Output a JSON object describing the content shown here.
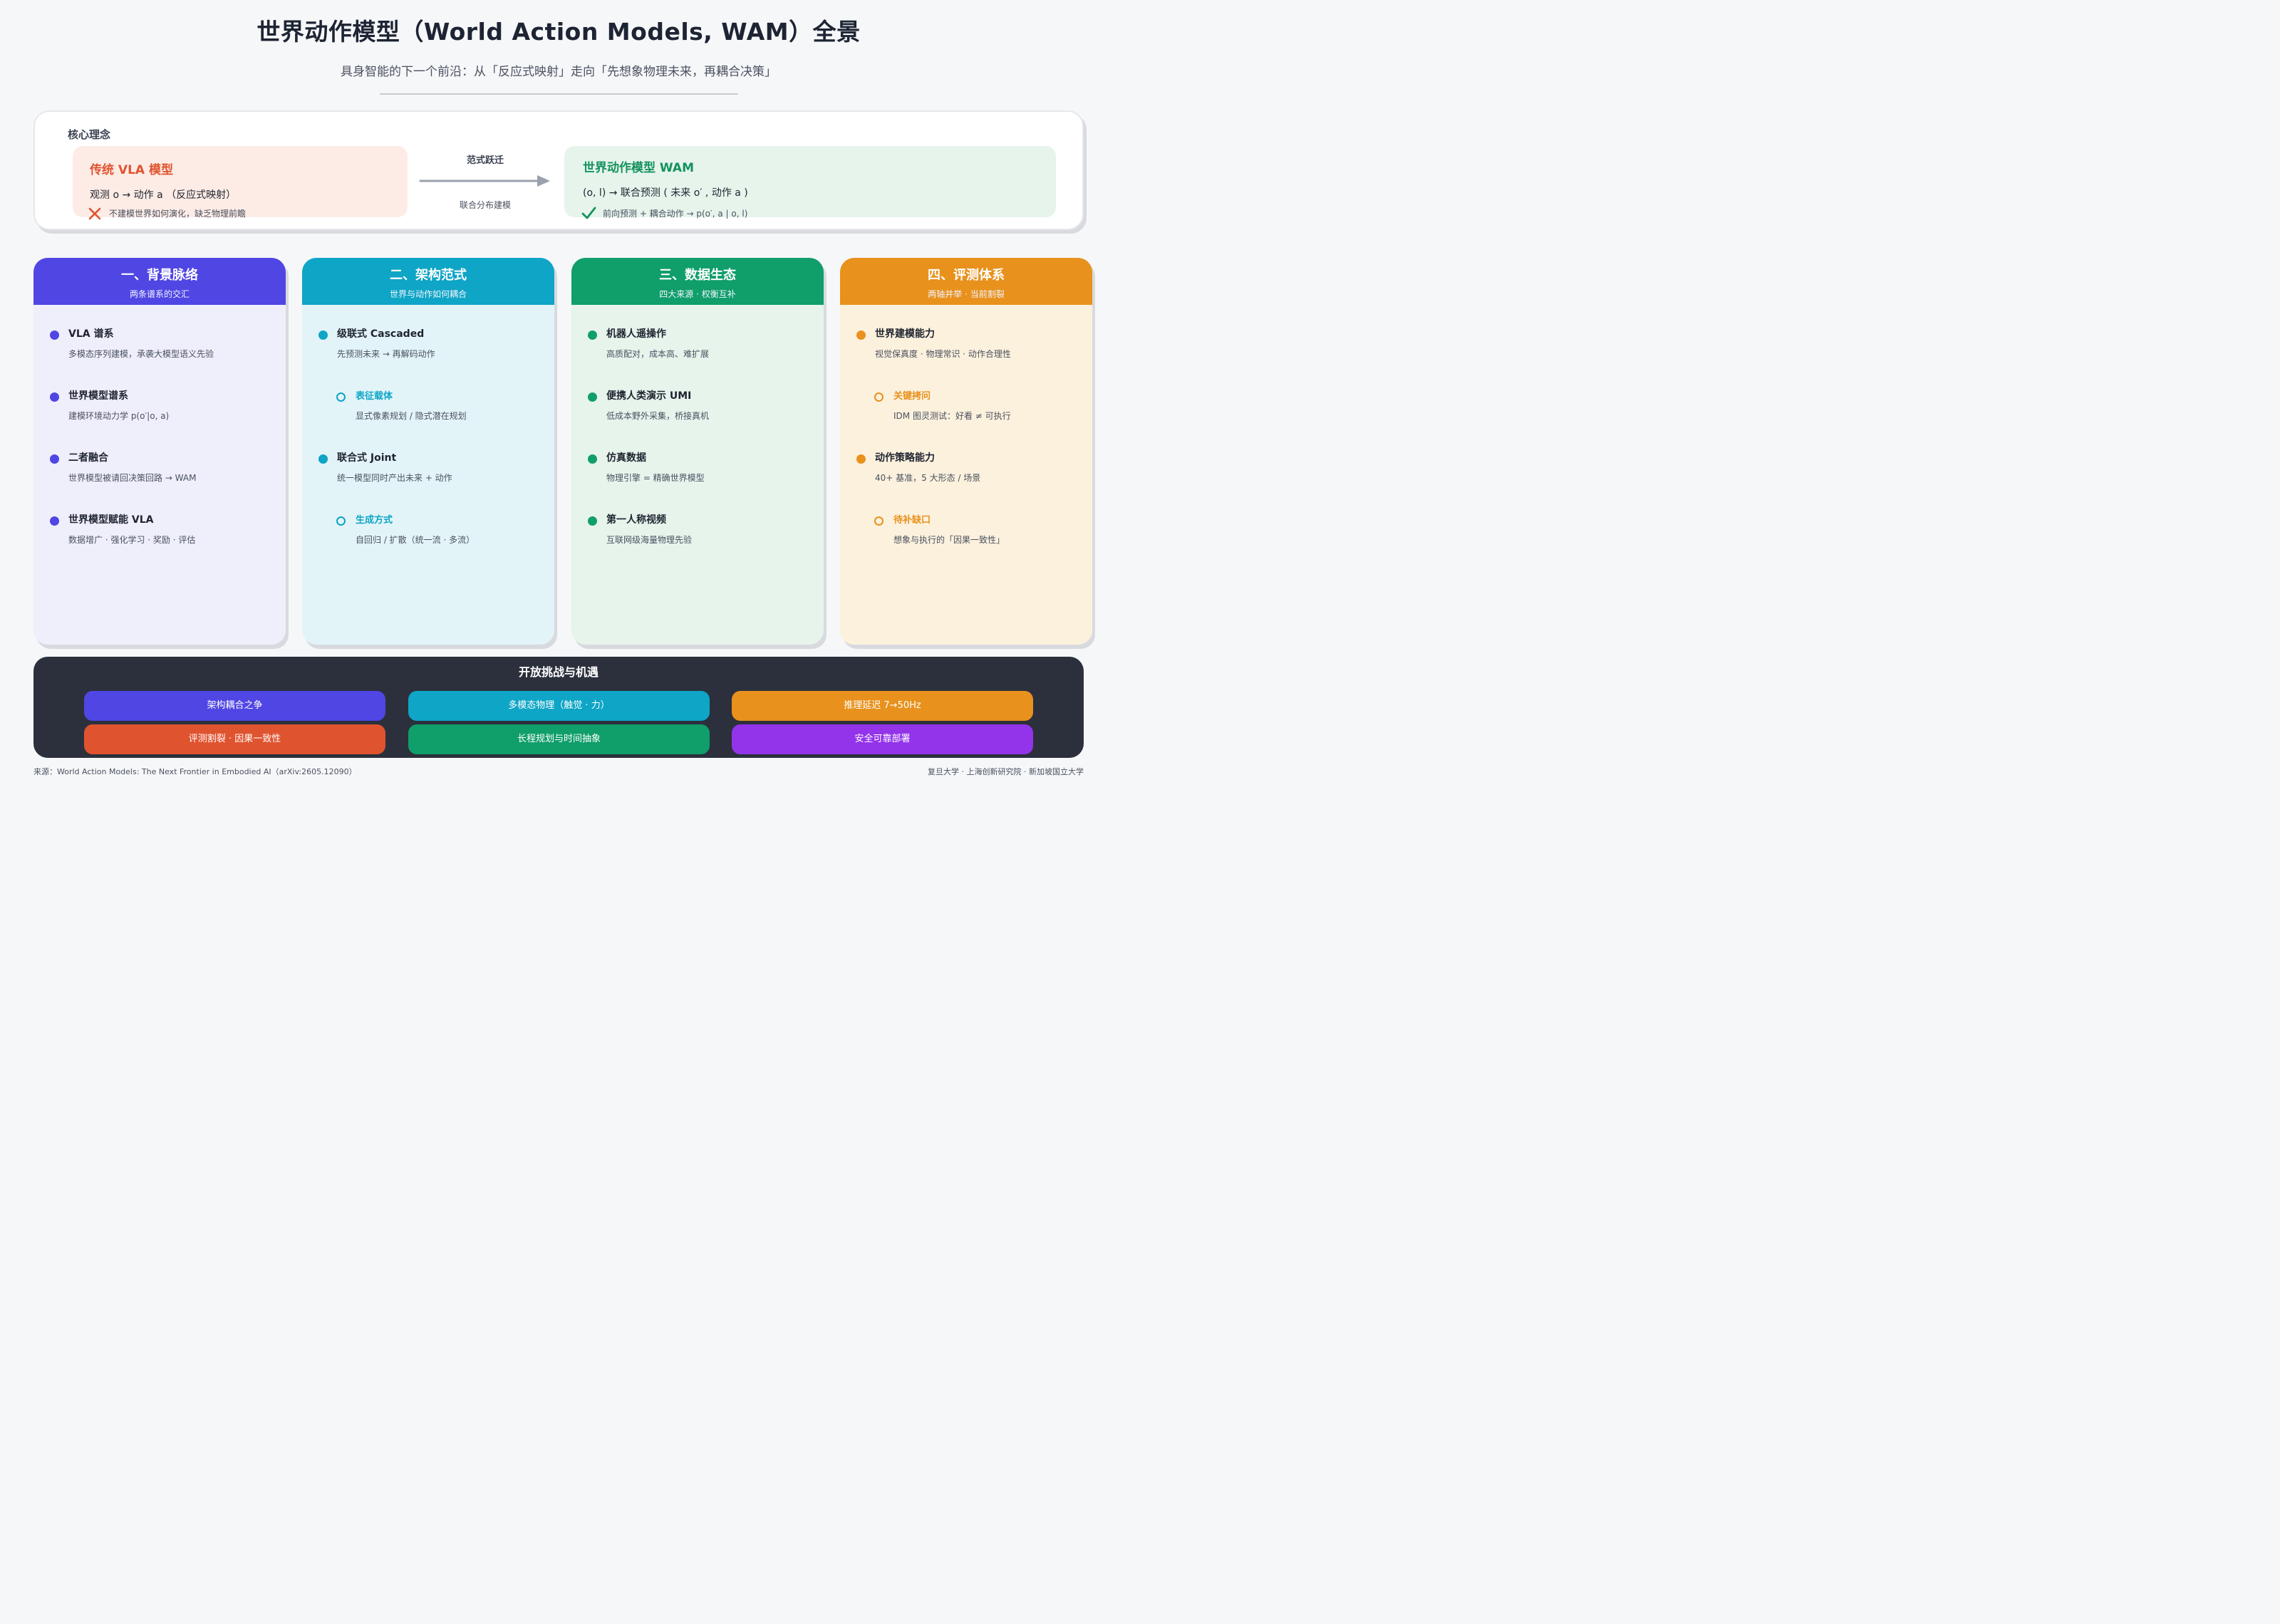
{
  "header": {
    "title": "世界动作模型（World Action Models, WAM）全景",
    "subtitle": "具身智能的下一个前沿：从「反应式映射」走向「先想象物理未来，再耦合决策」"
  },
  "core": {
    "label": "核心理念",
    "vla": {
      "title": "传统 VLA 模型",
      "formula": "观测 o  →  动作 a   （反应式映射）",
      "note": "不建模世界如何演化，缺乏物理前瞻",
      "color": "#e0532f"
    },
    "arrow": {
      "top_label": "范式跃迁",
      "bottom_label": "联合分布建模"
    },
    "wam": {
      "title": "世界动作模型 WAM",
      "formula": "(o, l)  →  联合预测 ( 未来 o′ , 动作 a )",
      "note": "前向预测 + 耦合动作  →  p(o′, a | o, l)",
      "color": "#14925d"
    }
  },
  "columns": [
    {
      "title": "一、背景脉络",
      "subtitle": "两条谱系的交汇",
      "color": "#5046e4",
      "bg": "#efeefb",
      "items": [
        {
          "title": "VLA 谱系",
          "desc": "多模态序列建模，承袭大模型语义先验",
          "sub": false
        },
        {
          "title": "世界模型谱系",
          "desc": "建模环境动力学 p(o′|o, a)",
          "sub": false
        },
        {
          "title": "二者融合",
          "desc": "世界模型被请回决策回路 → WAM",
          "sub": false
        },
        {
          "title": "世界模型赋能 VLA",
          "desc": "数据增广 · 强化学习 · 奖励 · 评估",
          "sub": false
        }
      ]
    },
    {
      "title": "二、架构范式",
      "subtitle": "世界与动作如何耦合",
      "color": "#0ea5c6",
      "bg": "#e3f4f8",
      "items": [
        {
          "title": "级联式 Cascaded",
          "desc": "先预测未来 → 再解码动作",
          "sub": false
        },
        {
          "title": "表征载体",
          "desc": "显式像素规划 / 隐式潜在规划",
          "sub": true
        },
        {
          "title": "联合式 Joint",
          "desc": "统一模型同时产出未来 + 动作",
          "sub": false
        },
        {
          "title": "生成方式",
          "desc": "自回归 / 扩散（统一流 · 多流）",
          "sub": true
        }
      ]
    },
    {
      "title": "三、数据生态",
      "subtitle": "四大来源 · 权衡互补",
      "color": "#109e6a",
      "bg": "#e6f4ec",
      "items": [
        {
          "title": "机器人遥操作",
          "desc": "高质配对，成本高、难扩展",
          "sub": false
        },
        {
          "title": "便携人类演示 UMI",
          "desc": "低成本野外采集，桥接真机",
          "sub": false
        },
        {
          "title": "仿真数据",
          "desc": "物理引擎 = 精确世界模型",
          "sub": false
        },
        {
          "title": "第一人称视频",
          "desc": "互联网级海量物理先验",
          "sub": false
        }
      ]
    },
    {
      "title": "四、评测体系",
      "subtitle": "两轴并举 · 当前割裂",
      "color": "#e8911c",
      "bg": "#fcf1dd",
      "items": [
        {
          "title": "世界建模能力",
          "desc": "视觉保真度 · 物理常识 · 动作合理性",
          "sub": false
        },
        {
          "title": "关键拷问",
          "desc": "IDM 图灵测试：好看 ≠ 可执行",
          "sub": true
        },
        {
          "title": "动作策略能力",
          "desc": "40+ 基准，5 大形态 / 场景",
          "sub": false
        },
        {
          "title": "待补缺口",
          "desc": "想象与执行的「因果一致性」",
          "sub": true
        }
      ]
    }
  ],
  "challenges": {
    "title": "开放挑战与机遇",
    "items": [
      {
        "label": "架构耦合之争",
        "color": "#5046e4"
      },
      {
        "label": "多模态物理（触觉 · 力）",
        "color": "#0ea5c6"
      },
      {
        "label": "推理延迟 7→50Hz",
        "color": "#e8911c"
      },
      {
        "label": "评测割裂 · 因果一致性",
        "color": "#e0532f"
      },
      {
        "label": "长程规划与时间抽象",
        "color": "#109e6a"
      },
      {
        "label": "安全可靠部署",
        "color": "#9333ea"
      }
    ]
  },
  "footer": {
    "source": "来源：World Action Models: The Next Frontier in Embodied AI（arXiv:2605.12090）",
    "affiliations": "复旦大学 · 上海创新研究院 · 新加坡国立大学"
  },
  "icons": {
    "vla_note_icon": "x-icon",
    "wam_note_icon": "check-icon",
    "arrow_icon": "arrow-right-icon"
  }
}
